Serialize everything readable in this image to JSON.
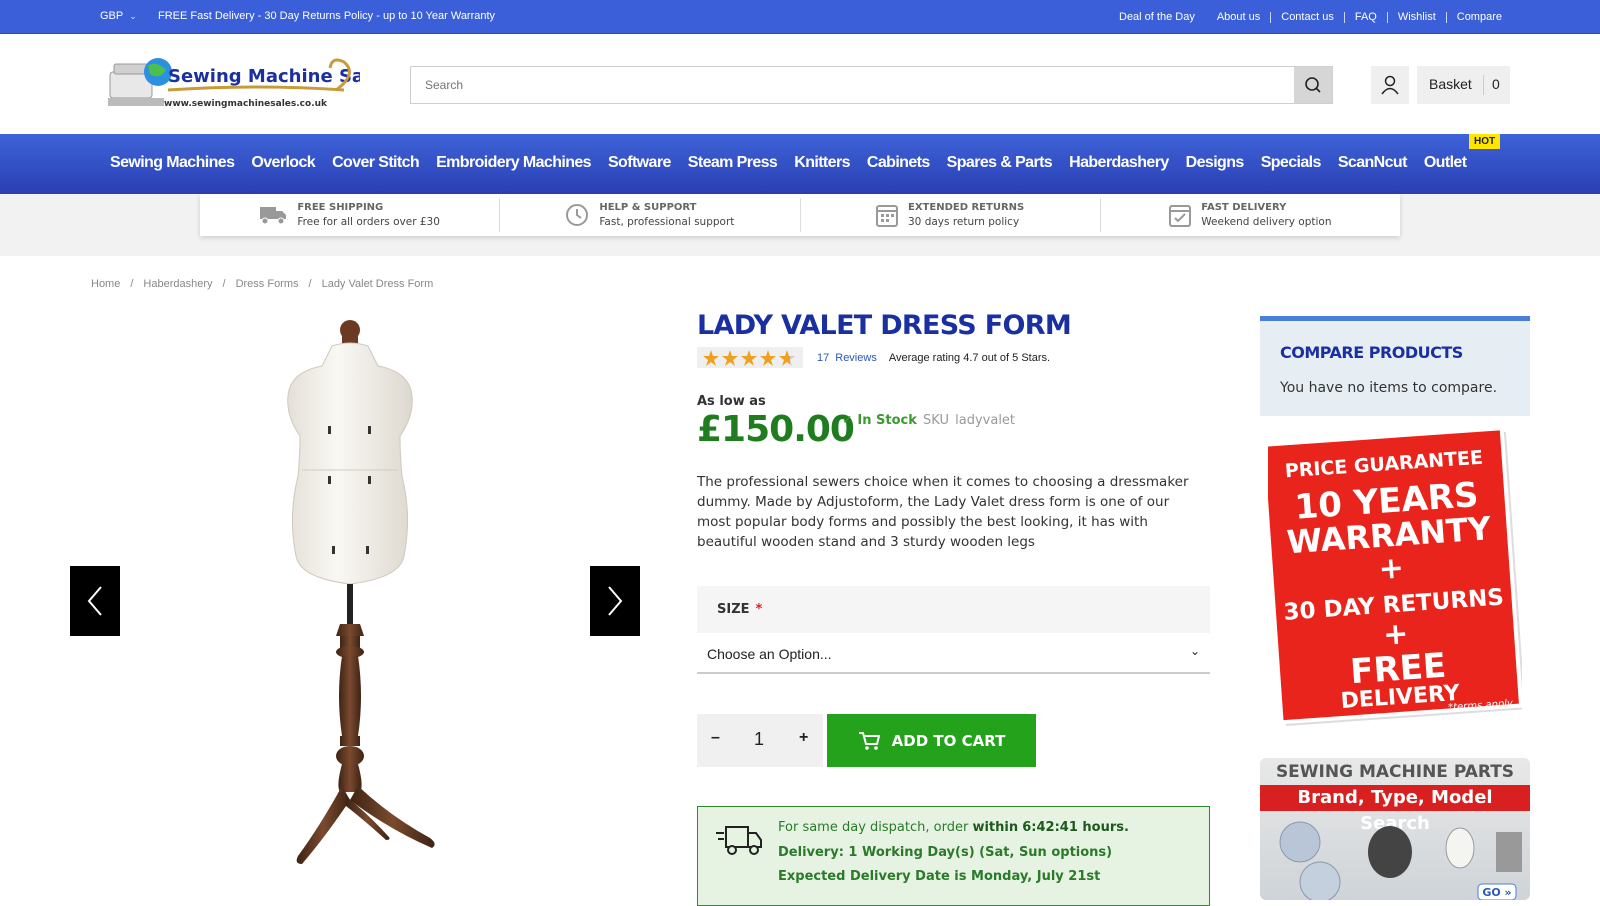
{
  "topbar": {
    "currency": "GBP",
    "promo": "FREE Fast Delivery - 30 Day Returns Policy - up to 10 Year Warranty",
    "links": [
      "Deal of the Day",
      "About us",
      "Contact us",
      "FAQ",
      "Wishlist",
      "Compare"
    ]
  },
  "header": {
    "logo_text": "Sewing Machine Sales",
    "logo_url_text": "www.sewingmachinesales.co.uk",
    "search_placeholder": "Search",
    "basket_label": "Basket",
    "basket_count": "0"
  },
  "nav": {
    "items": [
      "Sewing Machines",
      "Overlock",
      "Cover Stitch",
      "Embroidery Machines",
      "Software",
      "Steam Press",
      "Knitters",
      "Cabinets",
      "Spares & Parts",
      "Haberdashery",
      "Designs",
      "Specials",
      "ScanNcut",
      "Outlet"
    ],
    "hot_badge": "HOT"
  },
  "features": [
    {
      "title": "FREE SHIPPING",
      "sub": "Free for all orders over £30",
      "icon": "truck-icon"
    },
    {
      "title": "HELP & SUPPORT",
      "sub": "Fast, professional support",
      "icon": "clock-icon"
    },
    {
      "title": "EXTENDED RETURNS",
      "sub": "30 days return policy",
      "icon": "calendar-icon"
    },
    {
      "title": "FAST DELIVERY",
      "sub": "Weekend delivery option",
      "icon": "calendar-check-icon"
    }
  ],
  "breadcrumb": [
    "Home",
    "Haberdashery",
    "Dress Forms",
    "Lady Valet Dress Form"
  ],
  "product": {
    "title": "LADY VALET DRESS FORM",
    "rating": 4.7,
    "review_count": "17",
    "reviews_label": "Reviews",
    "avg_text": "Average rating 4.7 out of 5 Stars.",
    "as_low_as": "As low as",
    "price": "£150.00",
    "stock": "In Stock",
    "sku_label": "SKU",
    "sku": "ladyvalet",
    "description": "The professional sewers choice when it comes to choosing a dressmaker dummy. Made by Adjustoform, the Lady Valet dress form is one of our most popular body forms and possibly the best looking, it has with beautiful wooden stand and 3 sturdy wooden legs",
    "size_label": "SIZE",
    "size_required": "*",
    "size_option": "Choose an Option...",
    "qty_minus": "–",
    "qty": "1",
    "qty_plus": "+",
    "add_to_cart": "ADD TO CART"
  },
  "delivery": {
    "line1_prefix": "For same day dispatch, order",
    "line1_within": "within",
    "line1_time": "6:42:41 hours.",
    "line2": "Delivery: 1 Working Day(s) (Sat, Sun options)",
    "line3": "Expected Delivery Date is Monday, July 21st"
  },
  "compare": {
    "title": "COMPARE PRODUCTS",
    "empty": "You have no items to compare."
  },
  "banners": {
    "guarantee_top": "PRICE GUARANTEE",
    "guarantee_l1": "10 YEARS",
    "guarantee_l2": "WARRANTY",
    "guarantee_plus": "+",
    "guarantee_l3": "30 DAY RETURNS",
    "guarantee_l4": "FREE",
    "guarantee_l5": "DELIVERY",
    "guarantee_terms": "*terms apply",
    "parts_title": "SEWING MACHINE PARTS",
    "parts_sub": "Brand, Type, Model Search",
    "parts_go": "GO »"
  },
  "colors": {
    "brand_blue": "#3a5fd9",
    "title_blue": "#1a2fa0",
    "price_green": "#1f7d1f",
    "cart_green": "#24a21c"
  }
}
